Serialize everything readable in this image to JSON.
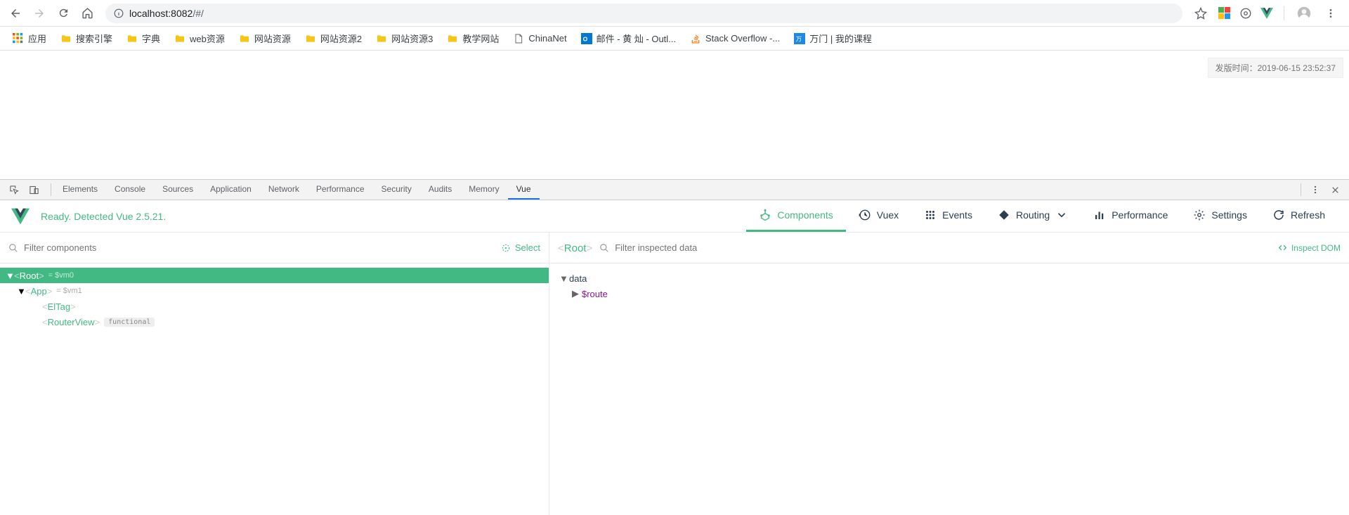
{
  "browser": {
    "url_prefix": "localhost:",
    "url_host": "8082",
    "url_path": "/#/",
    "bookmarks_label": "应用",
    "bookmarks": [
      {
        "label": "搜索引擎",
        "type": "folder"
      },
      {
        "label": "字典",
        "type": "folder"
      },
      {
        "label": "web资源",
        "type": "folder"
      },
      {
        "label": "网站资源",
        "type": "folder"
      },
      {
        "label": "网站资源2",
        "type": "folder"
      },
      {
        "label": "网站资源3",
        "type": "folder"
      },
      {
        "label": "教学网站",
        "type": "folder"
      },
      {
        "label": "ChinaNet",
        "type": "page"
      },
      {
        "label": "邮件 - 黄 灿 - Outl...",
        "type": "outlook"
      },
      {
        "label": "Stack Overflow -...",
        "type": "so"
      },
      {
        "label": "万门 | 我的课程",
        "type": "wanmen"
      }
    ]
  },
  "page": {
    "publish_label": "发版时间：2019-06-15 23:52:37"
  },
  "devtools": {
    "tabs": [
      "Elements",
      "Console",
      "Sources",
      "Application",
      "Network",
      "Performance",
      "Security",
      "Audits",
      "Memory",
      "Vue"
    ],
    "active_tab": "Vue"
  },
  "vue": {
    "status": "Ready. Detected Vue 2.5.21.",
    "tabs": [
      {
        "label": "Components",
        "icon": "components"
      },
      {
        "label": "Vuex",
        "icon": "history"
      },
      {
        "label": "Events",
        "icon": "grid"
      },
      {
        "label": "Routing",
        "icon": "diamond",
        "chevron": true
      },
      {
        "label": "Performance",
        "icon": "chart"
      },
      {
        "label": "Settings",
        "icon": "gear"
      },
      {
        "label": "Refresh",
        "icon": "refresh"
      }
    ],
    "active_vue_tab": "Components",
    "filter_components_placeholder": "Filter components",
    "filter_data_placeholder": "Filter inspected data",
    "select_label": "Select",
    "root_tag": "Root",
    "inspect_dom_label": "Inspect DOM",
    "tree": [
      {
        "name": "Root",
        "ref": "= $vm0",
        "selected": true,
        "caret": "▼",
        "indent": 0
      },
      {
        "name": "App",
        "ref": "= $vm1",
        "caret": "▼",
        "indent": 1
      },
      {
        "name": "ElTag",
        "indent": 2
      },
      {
        "name": "RouterView",
        "badge": "functional",
        "indent": 2
      }
    ],
    "data_label": "data",
    "data_items": [
      "$route"
    ]
  }
}
